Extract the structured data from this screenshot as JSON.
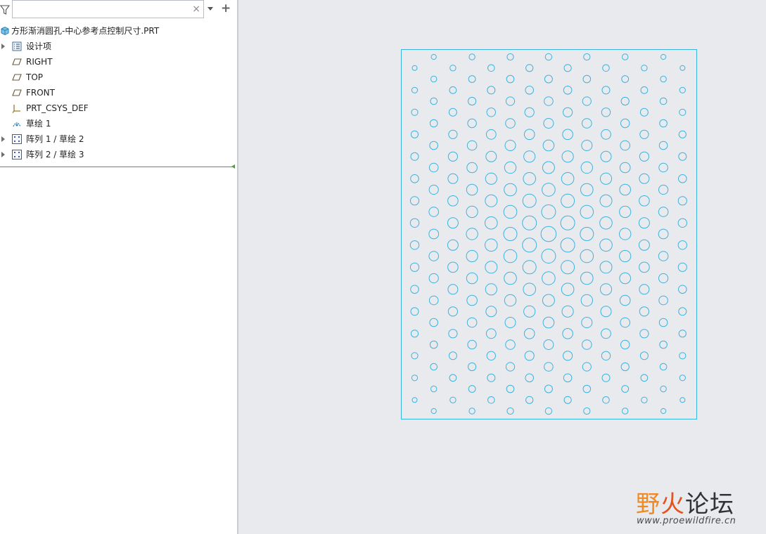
{
  "search": {
    "placeholder": "",
    "value": ""
  },
  "tree": {
    "root": {
      "label": "方形渐消圆孔-中心参考点控制尺寸.PRT",
      "icon": "part-icon"
    },
    "items": [
      {
        "label": "设计项",
        "icon": "design-items-icon",
        "expandable": true
      },
      {
        "label": "RIGHT",
        "icon": "datum-plane-icon",
        "expandable": false
      },
      {
        "label": "TOP",
        "icon": "datum-plane-icon",
        "expandable": false
      },
      {
        "label": "FRONT",
        "icon": "datum-plane-icon",
        "expandable": false
      },
      {
        "label": "PRT_CSYS_DEF",
        "icon": "coordinate-system-icon",
        "expandable": false
      },
      {
        "label": "草绘 1",
        "icon": "sketch-icon",
        "expandable": false
      },
      {
        "label": "阵列 1 / 草绘 2",
        "icon": "pattern-icon",
        "expandable": true
      },
      {
        "label": "阵列 2 / 草绘 3",
        "icon": "pattern-icon",
        "expandable": true
      }
    ]
  },
  "model": {
    "description_colors": {
      "outline": "#3bb3df",
      "background": "#e9eaee"
    },
    "hole_grid": {
      "rows": 33,
      "cols": 15
    }
  },
  "watermark": {
    "ye": "野",
    "huo": "火",
    "rest": "论坛",
    "url": "www.proewildfire.cn"
  },
  "colors": {
    "accent_green": "#43a62f",
    "panel_bg": "#ffffff",
    "viewport_bg": "#e9eaee"
  }
}
